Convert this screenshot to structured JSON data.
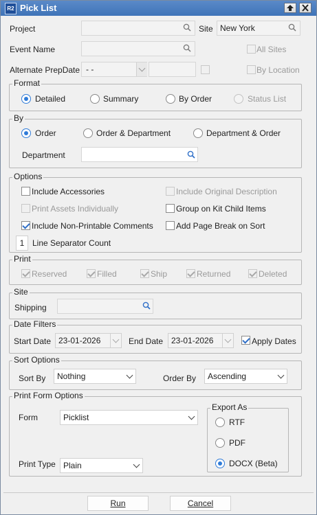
{
  "window": {
    "title": "Pick List",
    "logo": "R2"
  },
  "top": {
    "project_label": "Project",
    "site_label": "Site",
    "site_value": "New York",
    "event_name_label": "Event Name",
    "all_sites_label": "All Sites",
    "alt_prep_label": "Alternate PrepDate",
    "alt_prep_value": "- -",
    "by_location_label": "By Location"
  },
  "format": {
    "title": "Format",
    "options": [
      "Detailed",
      "Summary",
      "By Order",
      "Status List"
    ],
    "selected": "Detailed"
  },
  "by": {
    "title": "By",
    "options": [
      "Order",
      "Order & Department",
      "Department & Order"
    ],
    "selected": "Order",
    "department_label": "Department"
  },
  "options": {
    "title": "Options",
    "include_accessories": "Include Accessories",
    "include_original_description": "Include Original Description",
    "print_assets_individually": "Print Assets Individually",
    "group_on_kit_child_items": "Group on Kit Child Items",
    "include_non_printable_comments": "Include Non-Printable Comments",
    "add_page_break_on_sort": "Add Page Break on Sort",
    "line_separator_value": "1",
    "line_separator_label": "Line Separator Count"
  },
  "print": {
    "title": "Print",
    "items": [
      "Reserved",
      "Filled",
      "Ship",
      "Returned",
      "Deleted"
    ]
  },
  "site": {
    "title": "Site",
    "shipping_label": "Shipping"
  },
  "date_filters": {
    "title": "Date Filters",
    "start_label": "Start Date",
    "start_value": "23-01-2026",
    "end_label": "End Date",
    "end_value": "23-01-2026",
    "apply_label": "Apply Dates"
  },
  "sort": {
    "title": "Sort Options",
    "sort_by_label": "Sort By",
    "sort_by_value": "Nothing",
    "order_by_label": "Order By",
    "order_by_value": "Ascending"
  },
  "print_form": {
    "title": "Print Form Options",
    "form_label": "Form",
    "form_value": "Picklist",
    "print_type_label": "Print Type",
    "print_type_value": "Plain",
    "export_title": "Export As",
    "export_options": [
      "RTF",
      "PDF",
      "DOCX (Beta)"
    ],
    "export_selected": "DOCX (Beta)"
  },
  "footer": {
    "run_label": "Run",
    "cancel_label": "Cancel"
  },
  "colors": {
    "accent": "#2f7bd8",
    "titlebar": "#4a7fc1"
  }
}
